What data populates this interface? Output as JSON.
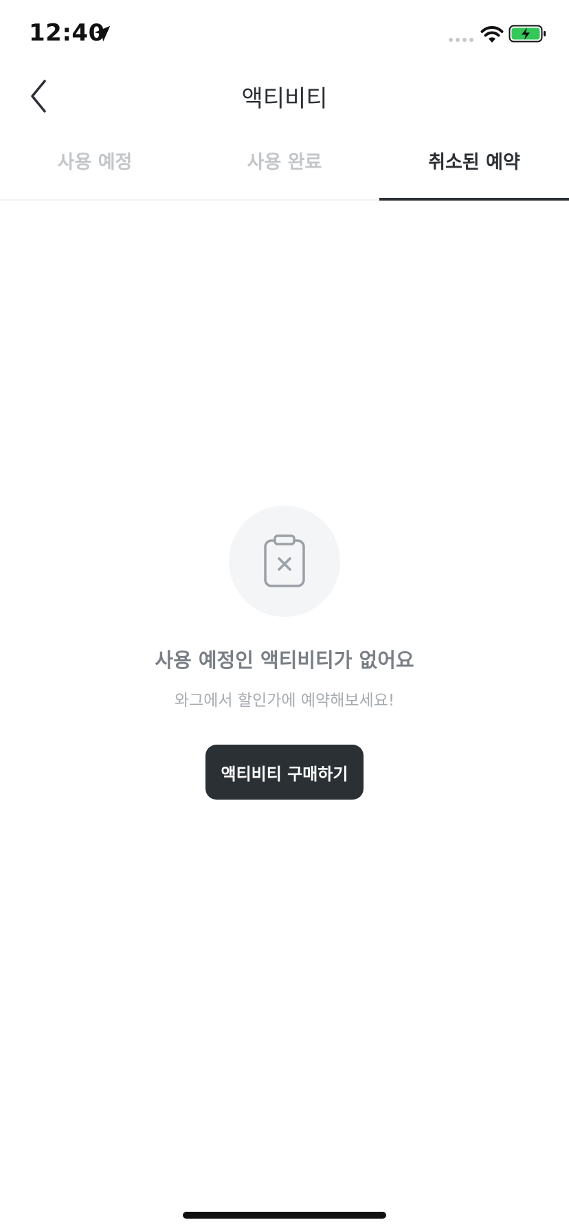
{
  "status_bar": {
    "time": "12:40",
    "icons": [
      "location-arrow-icon",
      "cellular-signal-icon",
      "wifi-icon",
      "battery-charging-icon"
    ],
    "battery_color": "#34c759"
  },
  "nav": {
    "title": "액티비티",
    "back_icon": "chevron-left-icon"
  },
  "tabs": [
    {
      "label": "사용 예정",
      "active": false
    },
    {
      "label": "사용 완료",
      "active": false
    },
    {
      "label": "취소된 예약",
      "active": true
    }
  ],
  "empty_state": {
    "icon": "clipboard-x-icon",
    "title": "사용 예정인 액티비티가 없어요",
    "subtitle": "와그에서 할인가에 예약해보세요!",
    "button_label": "액티비티 구매하기"
  },
  "colors": {
    "accent_dark": "#2b3034",
    "inactive_tab": "#c3c6c9",
    "empty_title": "#7a7f85",
    "empty_subtitle": "#a6abb0"
  }
}
